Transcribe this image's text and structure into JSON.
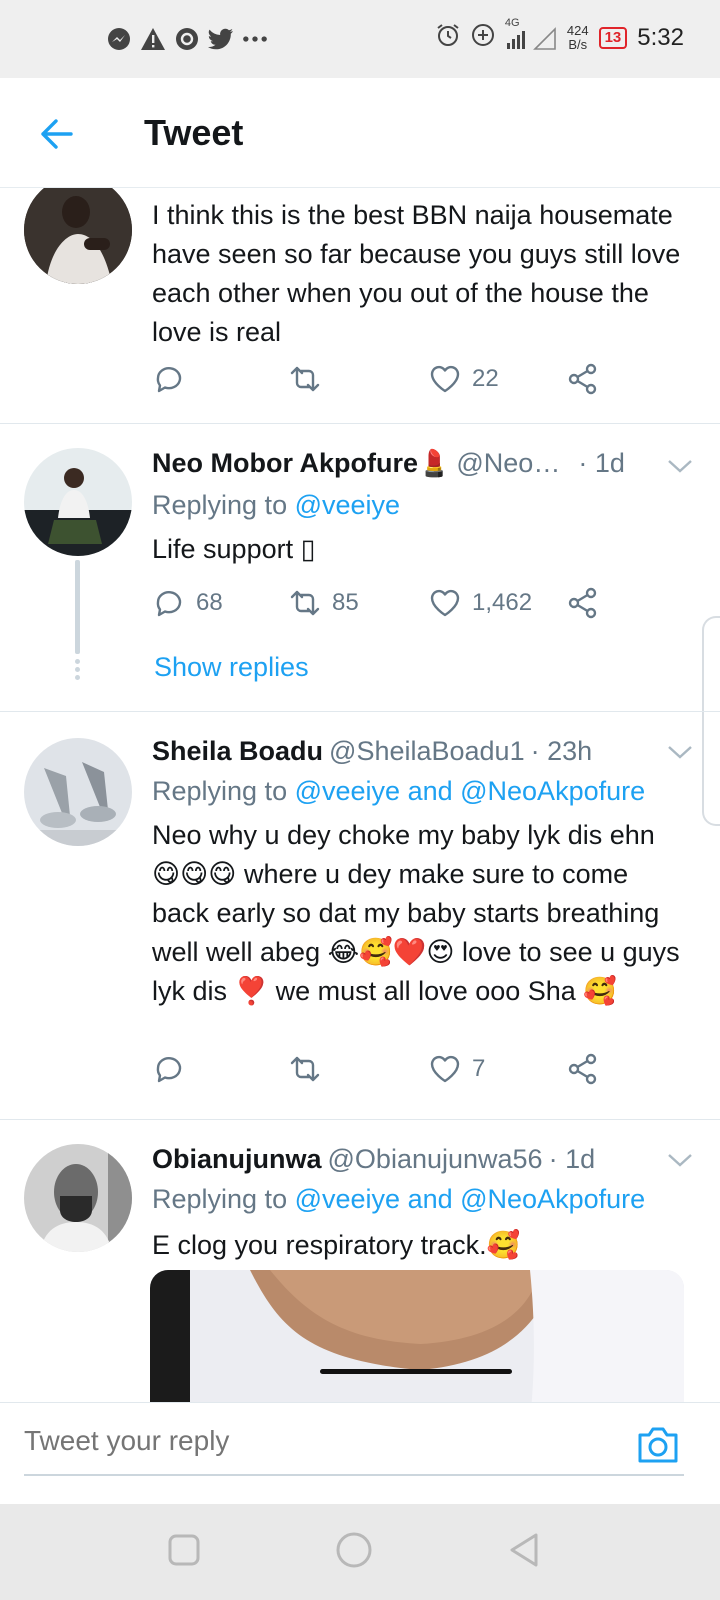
{
  "status_bar": {
    "left_icons": [
      "messenger-icon",
      "alert-icon",
      "vpn-icon",
      "twitter-icon",
      "more-dots-icon"
    ],
    "network": "4G",
    "speed": "424",
    "speed_unit": "B/s",
    "battery": "13",
    "time": "5:32"
  },
  "header": {
    "title": "Tweet"
  },
  "tweets": [
    {
      "text": "I think this is the best BBN naija housemate have seen so far because you guys still love each other when you out of the house the love is real",
      "replies": "",
      "retweets": "",
      "likes": "22"
    },
    {
      "name": "Neo Mobor Akpofure",
      "name_emoji": "💄",
      "handle": "@Neo…",
      "time": "· 1d",
      "replying_label": "Replying to",
      "replying_to": "@veeiye",
      "text": "Life support ▯",
      "replies": "68",
      "retweets": "85",
      "likes": "1,462",
      "show_replies": "Show replies"
    },
    {
      "name": "Sheila Boadu",
      "handle": "@SheilaBoadu1",
      "time": "· 23h",
      "replying_label": "Replying to",
      "replying_to": "@veeiye and @NeoAkpofure",
      "text": "Neo why u dey choke my baby lyk dis ehn 😋😋😋 where u dey make sure to come back early so dat my baby starts breathing well well abeg 😂🥰❤️😍 love to see u guys lyk dis ❣️ we must all love ooo Sha 🥰",
      "replies": "",
      "retweets": "",
      "likes": "7"
    },
    {
      "name": "Obianujunwa",
      "handle": "@Obianujunwa56",
      "time": "· 1d",
      "replying_label": "Replying to",
      "replying_to": "@veeiye and @NeoAkpofure",
      "text": "E clog you respiratory track.🥰"
    }
  ],
  "composer": {
    "placeholder": "Tweet your reply"
  },
  "colors": {
    "accent": "#1da1f2",
    "secondary_text": "#657786",
    "divider": "#e1e8ed"
  }
}
